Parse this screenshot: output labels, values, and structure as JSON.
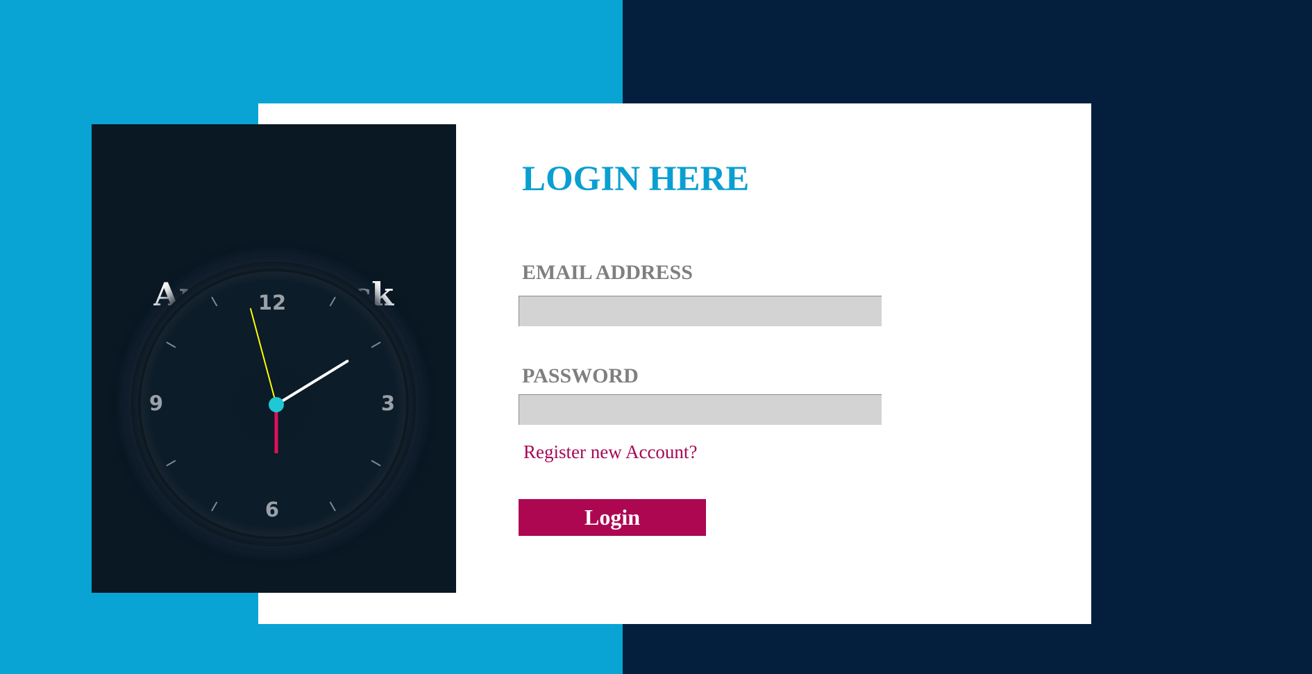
{
  "colors": {
    "left_background": "#09a4d4",
    "right_background": "#031f3d",
    "clock_panel": "#0a1823",
    "accent": "#0b9fd1",
    "button": "#ae0752",
    "hour_hand": "#ffffff",
    "minute_hand": "#ffff00",
    "second_hand": "#e0105a",
    "center_dot": "#1ec8d4"
  },
  "clock": {
    "title": "Analog Clock",
    "numbers": [
      "12",
      "3",
      "6",
      "9"
    ],
    "time": {
      "hour": 1,
      "minute": 57,
      "second": 30
    }
  },
  "login": {
    "title": "LOGIN HERE",
    "email_label": "EMAIL ADDRESS",
    "email_value": "",
    "password_label": "PASSWORD",
    "password_value": "",
    "register_link": "Register new Account?",
    "button_label": "Login"
  }
}
